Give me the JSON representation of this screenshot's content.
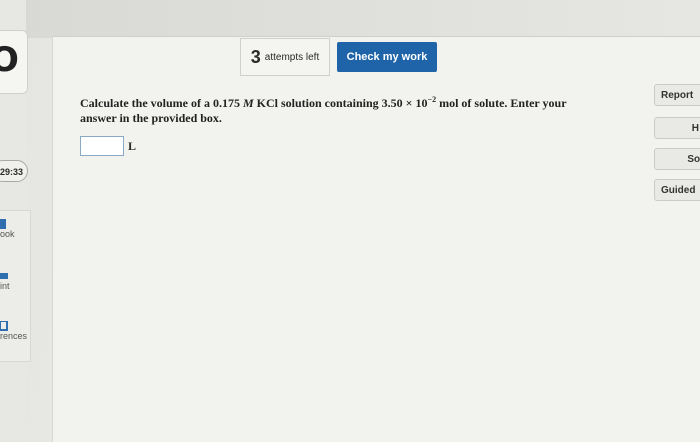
{
  "sidebar": {
    "logo_glyph": "O",
    "timer": "29:33",
    "tools": [
      {
        "label": "ook",
        "icon": "book-icon"
      },
      {
        "label": "int",
        "icon": "print-icon"
      },
      {
        "label": "rences",
        "icon": "references-icon"
      }
    ]
  },
  "toolbar": {
    "attempts_count": "3",
    "attempts_text": "attempts left",
    "check_label": "Check my work"
  },
  "question": {
    "text_before": "Calculate the volume of a 0.175 ",
    "unit_M": "M",
    "text_mid": " KCl solution containing 3.50 × 10",
    "exponent": "−2",
    "text_after": " mol of solute. Enter your answer in the provided box.",
    "answer_value": "",
    "answer_unit": "L"
  },
  "right_buttons": [
    "Report",
    "H",
    "Solu",
    "Guided"
  ],
  "colors": {
    "accent": "#1f64a8"
  }
}
